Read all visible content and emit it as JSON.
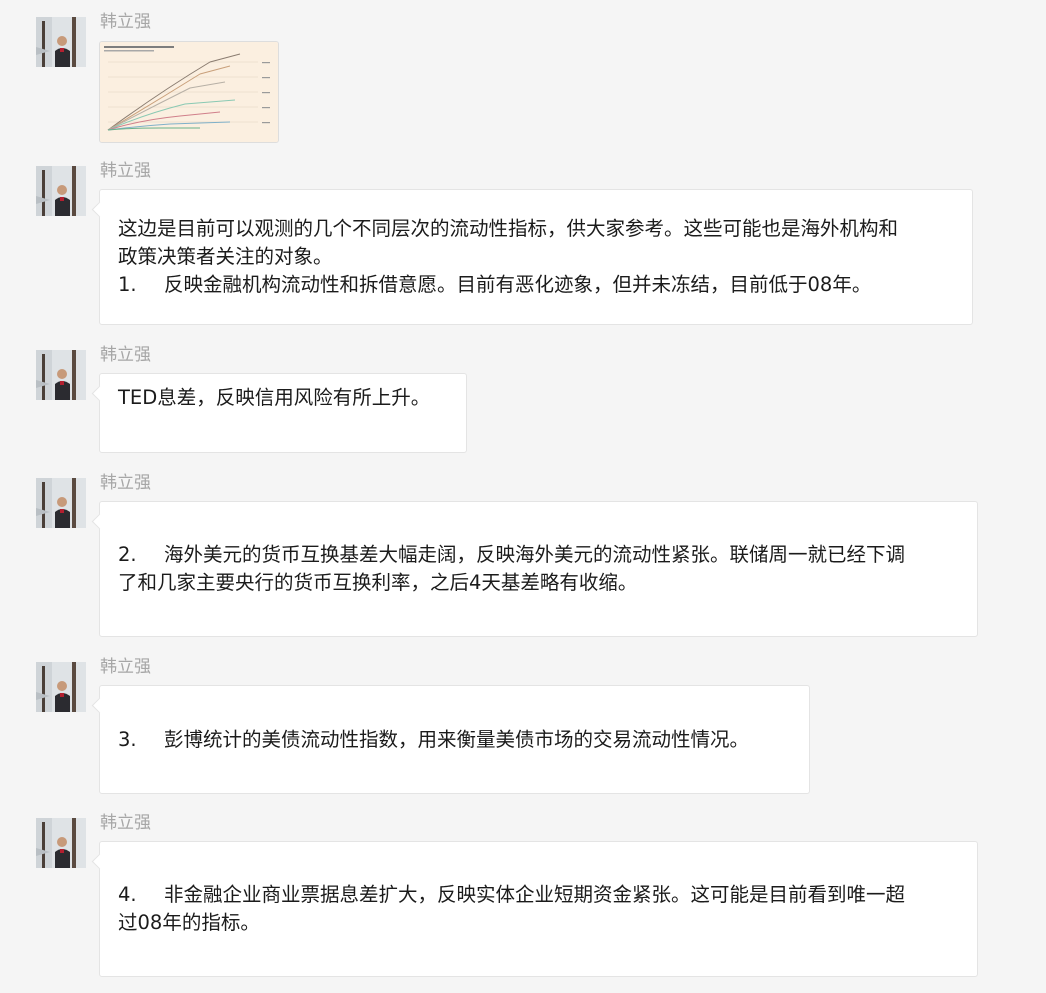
{
  "chat": {
    "messages": [
      {
        "sender": "韩立强",
        "type": "image"
      },
      {
        "sender": "韩立强",
        "lines": [
          "这边是目前可以观测的几个不同层次的流动性指标，供大家参考。这些可能也是海外机构和",
          "政策决策者关注的对象。"
        ],
        "item": {
          "num": "1.",
          "text": "反映金融机构流动性和拆借意愿。目前有恶化迹象，但并未冻结，目前低于08年。"
        }
      },
      {
        "sender": "韩立强",
        "lines": [
          "TED息差，反映信用风险有所上升。"
        ]
      },
      {
        "sender": "韩立强",
        "item": {
          "num": "2.",
          "text": "海外美元的货币互换基差大幅走阔，反映海外美元的流动性紧张。联储周一就已经下调"
        },
        "lines_after": [
          "了和几家主要央行的货币互换利率，之后4天基差略有收缩。"
        ]
      },
      {
        "sender": "韩立强",
        "item": {
          "num": "3.",
          "text": "彭博统计的美债流动性指数，用来衡量美债市场的交易流动性情况。"
        }
      },
      {
        "sender": "韩立强",
        "item": {
          "num": "4.",
          "text": "非金融企业商业票据息差扩大，反映实体企业短期资金紧张。这可能是目前看到唯一超"
        },
        "lines_after": [
          "过08年的指标。"
        ]
      }
    ]
  },
  "colors": {
    "background": "#f5f5f5",
    "bubble": "#ffffff",
    "sender": "#a6a6a6",
    "text": "#1b1b1b",
    "thumb_bg": "#fbefe0"
  },
  "icons": {
    "avatar": "person-photo-snow"
  }
}
